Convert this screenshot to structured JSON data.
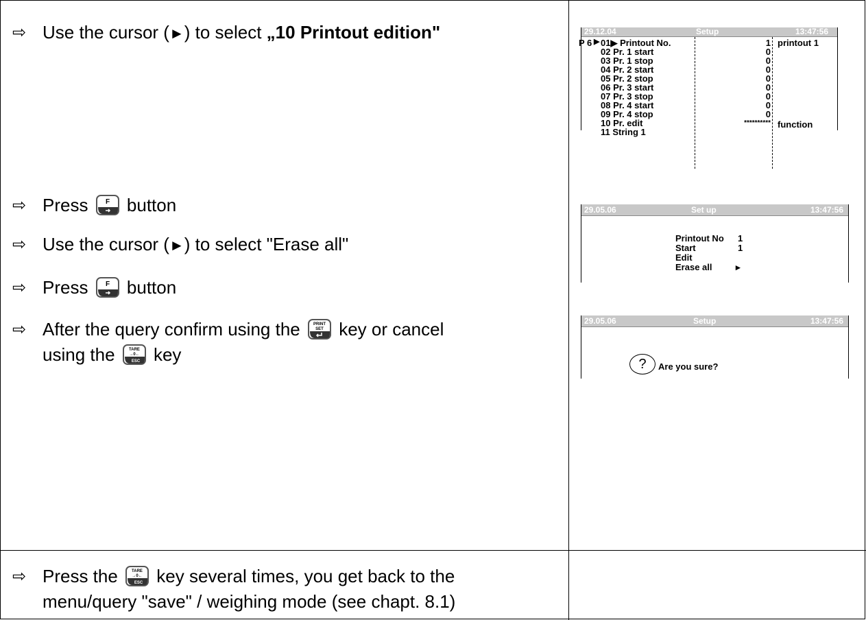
{
  "steps": {
    "s1": {
      "prefix": "Use the cursor (",
      "cursor": "►",
      "middle": ") to select ",
      "bold": "„10 Printout edition\""
    },
    "s2": {
      "before": "Press ",
      "key": "F",
      "after": " button"
    },
    "s3": {
      "prefix": "Use the cursor (",
      "cursor": "►",
      "suffix": ") to select \"Erase all\""
    },
    "s4": {
      "before": "Press ",
      "key": "F",
      "after": " button"
    },
    "s5": {
      "line1a": "After the query confirm using the ",
      "key1": "PRINT SET",
      "line1b": " key or cancel",
      "line2a": "using the ",
      "key2": "TARE ESC",
      "line2b": " key"
    },
    "s6": {
      "line1a": "Press the ",
      "key": "TARE ESC",
      "line1b": " key several times, you get back to the",
      "line2": "menu/query \"save\" / weighing mode (see chapt. 8.1)"
    }
  },
  "arrow_symbol": "⇨",
  "screen1": {
    "date": "29.12.04",
    "title": "Setup",
    "time": "13:47:56",
    "prefix": "P 6",
    "rows": [
      {
        "label": "01▶ Printout No.",
        "value": "1",
        "extra": "printout 1"
      },
      {
        "label": "02  Pr. 1 start",
        "value": "0",
        "extra": ""
      },
      {
        "label": "03  Pr. 1 stop",
        "value": "0",
        "extra": ""
      },
      {
        "label": "04  Pr. 2 start",
        "value": "0",
        "extra": ""
      },
      {
        "label": "05  Pr. 2 stop",
        "value": "0",
        "extra": ""
      },
      {
        "label": "06  Pr. 3 start",
        "value": "0",
        "extra": ""
      },
      {
        "label": "07  Pr. 3 stop",
        "value": "0",
        "extra": ""
      },
      {
        "label": "08  Pr. 4 start",
        "value": "0",
        "extra": ""
      },
      {
        "label": "09  Pr. 4 stop",
        "value": "0",
        "extra": ""
      },
      {
        "label": "10  Pr. edit",
        "value": "**********",
        "extra": "function"
      },
      {
        "label": "11   String 1",
        "value": "",
        "extra": ""
      }
    ]
  },
  "screen2": {
    "date": "29.05.06",
    "title": "Set up",
    "time": "13:47:56",
    "items": [
      {
        "label": "Printout No",
        "value": "1"
      },
      {
        "label": "Start",
        "value": "1"
      },
      {
        "label": "Edit",
        "value": ""
      },
      {
        "label": "Erase all",
        "value": "▸"
      }
    ]
  },
  "screen3": {
    "date": "29.05.06",
    "title": "Setup",
    "time": "13:47:56",
    "question_icon": "?",
    "question": "Are you sure?"
  }
}
